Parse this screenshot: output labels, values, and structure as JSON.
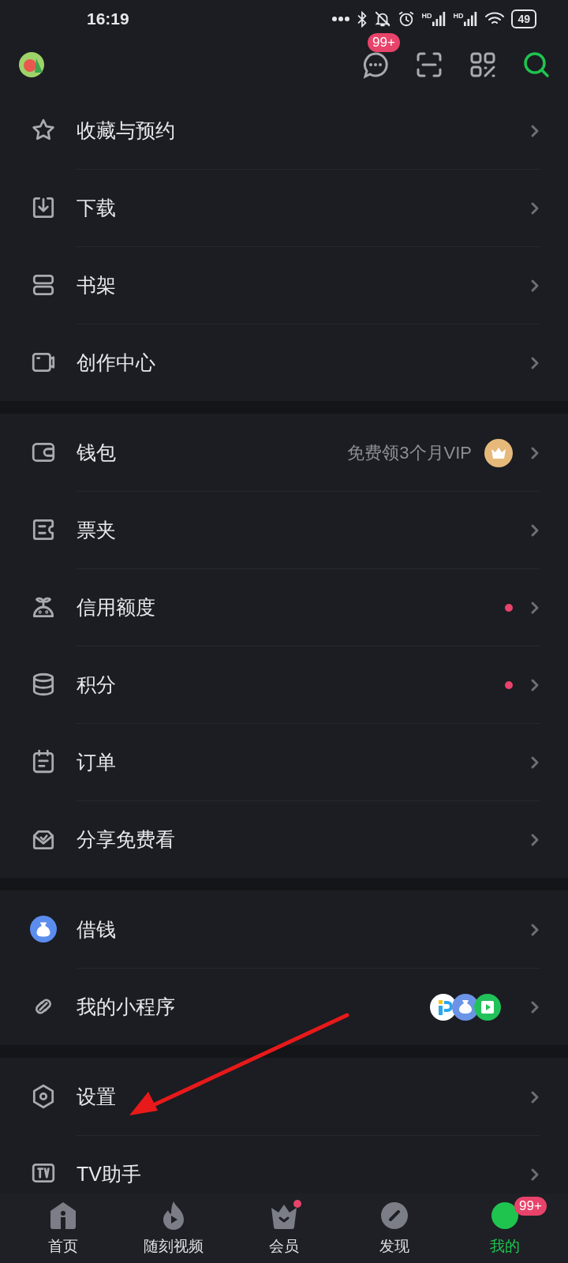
{
  "status_bar": {
    "time": "16:19",
    "signal_labels": [
      "HD",
      "HD"
    ],
    "battery": "49"
  },
  "header": {
    "message_badge": "99+"
  },
  "sections": [
    {
      "rows": [
        {
          "kind": "star",
          "label": "收藏与预约",
          "dot": false
        },
        {
          "kind": "download",
          "label": "下载",
          "dot": false
        },
        {
          "kind": "shelf",
          "label": "书架",
          "dot": false
        },
        {
          "kind": "creator",
          "label": "创作中心",
          "dot": false
        }
      ]
    },
    {
      "rows": [
        {
          "kind": "wallet",
          "label": "钱包",
          "hint": "免费领3个月VIP",
          "trailing": {
            "kind": "vip"
          },
          "dot": false
        },
        {
          "kind": "ticket",
          "label": "票夹",
          "dot": false
        },
        {
          "kind": "credit",
          "label": "信用额度",
          "dot": true
        },
        {
          "kind": "points",
          "label": "积分",
          "dot": true
        },
        {
          "kind": "order",
          "label": "订单",
          "dot": false
        },
        {
          "kind": "share",
          "label": "分享免费看",
          "dot": false
        }
      ]
    },
    {
      "rows": [
        {
          "kind": "loan",
          "label": "借钱",
          "dot": false
        },
        {
          "kind": "link",
          "label": "我的小程序",
          "trailing": {
            "kind": "apps"
          },
          "dot": false
        }
      ]
    },
    {
      "rows": [
        {
          "kind": "settings",
          "label": "设置",
          "dot": false
        },
        {
          "kind": "tv",
          "label": "TV助手",
          "dot": false
        }
      ]
    }
  ],
  "annotation": {
    "kind": "arrow"
  },
  "bottom_nav": [
    {
      "kind": "home",
      "label": "首页",
      "selected": false,
      "dot": false
    },
    {
      "kind": "flame",
      "label": "随刻视频",
      "selected": false,
      "dot": false
    },
    {
      "kind": "crown",
      "label": "会员",
      "selected": false,
      "dot": true
    },
    {
      "kind": "compass",
      "label": "发现",
      "selected": false,
      "dot": false
    },
    {
      "kind": "me",
      "label": "我的",
      "selected": true,
      "dot": false,
      "badge": "99+"
    }
  ]
}
